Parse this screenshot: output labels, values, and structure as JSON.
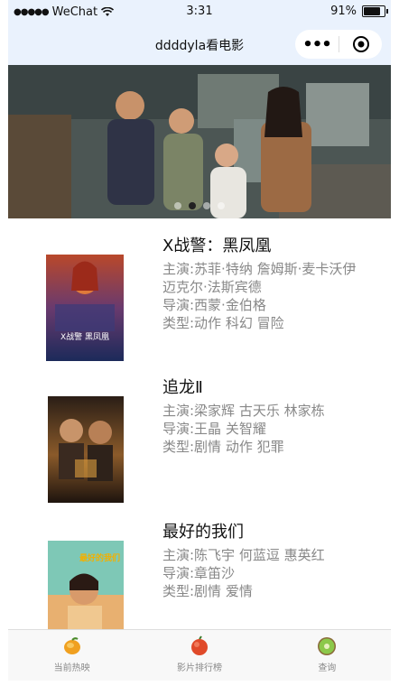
{
  "status_bar": {
    "carrier": "WeChat",
    "time": "3:31",
    "battery": "91%",
    "battery_level": 0.91
  },
  "navbar": {
    "title": "ddddyla看电影",
    "more_icon": "more-icon",
    "close_icon": "target-icon"
  },
  "banner": {
    "slides": 4,
    "active_index": 1
  },
  "movies": [
    {
      "name": "X战警：黑凤凰",
      "cast_lines": [
        "主演:苏菲·特纳  詹姆斯·麦卡沃伊",
        "迈克尔·法斯宾德"
      ],
      "director": "导演:西蒙·金伯格",
      "genre": "类型:动作  科幻  冒险",
      "poster_text": "X战警 黑凤凰"
    },
    {
      "name": "追龙Ⅱ",
      "cast_lines": [
        "主演:梁家辉  古天乐  林家栋"
      ],
      "director": "导演:王晶  关智耀",
      "genre": "类型:剧情  动作  犯罪"
    },
    {
      "name": "最好的我们",
      "cast_lines": [
        "主演:陈飞宇  何蓝逗  惠英红"
      ],
      "director": "导演:章笛沙",
      "genre": "类型:剧情  爱情",
      "poster_text": "最好的我们"
    }
  ],
  "tabs": [
    {
      "label": "当前热映",
      "icon": "mango-icon"
    },
    {
      "label": "影片排行榜",
      "icon": "apple-icon"
    },
    {
      "label": "查询",
      "icon": "kiwi-icon"
    }
  ],
  "colors": {
    "nav_bg": "#eaf2fd",
    "meta_text": "#888888",
    "title_text": "#111111"
  }
}
